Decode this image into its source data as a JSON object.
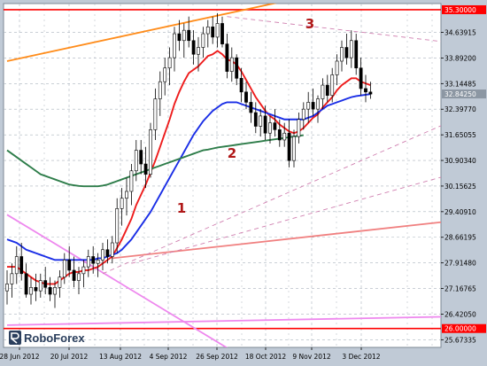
{
  "chart_data": {
    "type": "line",
    "title": "",
    "xlabel": "",
    "ylabel": "",
    "ylim": [
      25.45,
      35.48
    ],
    "grid": true,
    "x_tick_labels": [
      "28 Jun 2012",
      "20 Jul 2012",
      "13 Aug 2012",
      "4 Sep 2012",
      "26 Sep 2012",
      "18 Oct 2012",
      "9 Nov 2012",
      "3 Dec 2012"
    ],
    "y_tick_labels": [
      "34.63915",
      "33.89200",
      "33.14485",
      "32.39770",
      "31.65055",
      "30.90340",
      "30.15625",
      "29.40910",
      "28.66195",
      "27.91480",
      "27.16765",
      "26.42050",
      "25.67335"
    ],
    "y_tick_values": [
      34.63915,
      33.892,
      33.14485,
      32.3977,
      31.65055,
      30.9034,
      30.15625,
      29.4091,
      28.66195,
      27.9148,
      27.16765,
      26.4205,
      25.67335
    ],
    "level_labels": [
      "35.30000",
      "26.00000"
    ],
    "level_values": [
      35.3,
      26.0
    ],
    "current_price_label": "32.84250",
    "current_price": 32.8425,
    "candles": [
      [
        27.1,
        27.7,
        26.7,
        27.3
      ],
      [
        27.3,
        27.9,
        26.9,
        27.6
      ],
      [
        27.6,
        28.4,
        27.3,
        28.1
      ],
      [
        28.1,
        28.5,
        27.4,
        27.6
      ],
      [
        27.6,
        27.9,
        26.9,
        27.0
      ],
      [
        27.0,
        27.5,
        26.7,
        27.2
      ],
      [
        27.2,
        27.6,
        26.8,
        27.1
      ],
      [
        27.1,
        27.6,
        26.9,
        27.4
      ],
      [
        27.4,
        27.8,
        27.0,
        27.2
      ],
      [
        27.2,
        27.5,
        26.8,
        27.0
      ],
      [
        27.0,
        27.4,
        26.6,
        27.2
      ],
      [
        27.2,
        27.7,
        26.9,
        27.5
      ],
      [
        27.5,
        28.2,
        27.3,
        28.0
      ],
      [
        28.0,
        28.4,
        27.5,
        27.7
      ],
      [
        27.7,
        28.1,
        27.2,
        27.4
      ],
      [
        27.4,
        27.8,
        27.0,
        27.6
      ],
      [
        27.6,
        28.0,
        27.2,
        27.8
      ],
      [
        27.8,
        28.3,
        27.5,
        28.1
      ],
      [
        28.1,
        28.4,
        27.6,
        27.9
      ],
      [
        27.9,
        28.2,
        27.5,
        28.0
      ],
      [
        28.0,
        28.5,
        27.7,
        28.3
      ],
      [
        28.3,
        28.6,
        27.9,
        28.1
      ],
      [
        28.1,
        28.7,
        27.9,
        28.5
      ],
      [
        28.5,
        29.8,
        28.2,
        29.5
      ],
      [
        29.5,
        30.1,
        29.0,
        29.8
      ],
      [
        29.8,
        30.4,
        29.3,
        30.0
      ],
      [
        30.0,
        30.8,
        29.6,
        30.6
      ],
      [
        30.6,
        31.5,
        30.3,
        31.2
      ],
      [
        31.2,
        31.5,
        30.5,
        30.8
      ],
      [
        30.8,
        31.3,
        30.1,
        30.5
      ],
      [
        30.5,
        32.0,
        30.4,
        31.8
      ],
      [
        31.8,
        33.0,
        31.5,
        32.7
      ],
      [
        32.7,
        33.5,
        32.2,
        33.2
      ],
      [
        33.2,
        33.9,
        32.8,
        33.6
      ],
      [
        33.6,
        34.2,
        33.1,
        33.9
      ],
      [
        33.9,
        34.8,
        33.5,
        34.6
      ],
      [
        34.6,
        35.0,
        34.1,
        34.4
      ],
      [
        34.4,
        34.9,
        33.9,
        34.7
      ],
      [
        34.7,
        35.1,
        34.2,
        34.4
      ],
      [
        34.4,
        34.7,
        33.7,
        34.0
      ],
      [
        34.0,
        34.5,
        33.5,
        34.2
      ],
      [
        34.2,
        34.8,
        33.9,
        34.6
      ],
      [
        34.6,
        35.0,
        34.2,
        34.8
      ],
      [
        34.8,
        35.1,
        34.3,
        34.5
      ],
      [
        34.5,
        35.2,
        34.2,
        34.9
      ],
      [
        34.9,
        35.1,
        34.2,
        34.3
      ],
      [
        34.3,
        34.6,
        33.3,
        33.5
      ],
      [
        33.5,
        34.2,
        33.2,
        33.9
      ],
      [
        33.9,
        34.0,
        33.1,
        33.3
      ],
      [
        33.3,
        33.6,
        32.6,
        32.9
      ],
      [
        32.9,
        33.2,
        32.4,
        32.6
      ],
      [
        32.6,
        32.9,
        32.0,
        32.3
      ],
      [
        32.3,
        32.6,
        31.7,
        31.9
      ],
      [
        31.9,
        32.4,
        31.6,
        32.2
      ],
      [
        32.2,
        32.5,
        31.5,
        31.7
      ],
      [
        31.7,
        32.2,
        31.4,
        32.0
      ],
      [
        32.0,
        32.4,
        31.6,
        31.8
      ],
      [
        31.8,
        32.1,
        31.3,
        31.5
      ],
      [
        31.5,
        32.0,
        31.3,
        31.7
      ],
      [
        31.7,
        32.1,
        30.7,
        30.9
      ],
      [
        30.9,
        31.8,
        30.7,
        31.6
      ],
      [
        31.6,
        32.3,
        31.4,
        32.1
      ],
      [
        32.1,
        32.6,
        31.8,
        32.4
      ],
      [
        32.4,
        32.9,
        32.0,
        32.6
      ],
      [
        32.6,
        33.0,
        32.2,
        32.4
      ],
      [
        32.4,
        32.8,
        32.0,
        32.7
      ],
      [
        32.7,
        33.3,
        32.4,
        33.1
      ],
      [
        33.1,
        33.4,
        32.6,
        32.8
      ],
      [
        32.8,
        33.6,
        32.6,
        33.4
      ],
      [
        33.4,
        34.0,
        33.1,
        33.8
      ],
      [
        33.8,
        34.4,
        33.5,
        34.2
      ],
      [
        34.2,
        34.6,
        33.7,
        33.9
      ],
      [
        33.9,
        34.7,
        33.6,
        34.4
      ],
      [
        34.4,
        34.6,
        33.4,
        33.6
      ],
      [
        33.6,
        33.9,
        32.8,
        33.0
      ],
      [
        33.0,
        33.4,
        32.6,
        32.9
      ],
      [
        32.9,
        33.2,
        32.7,
        32.84
      ]
    ],
    "series": [
      {
        "color": "#ee1c1c",
        "values": [
          27.8,
          27.8,
          27.8,
          27.7,
          27.6,
          27.5,
          27.4,
          27.35,
          27.3,
          27.3,
          27.3,
          27.4,
          27.5,
          27.6,
          27.65,
          27.65,
          27.7,
          27.7,
          27.75,
          27.8,
          27.9,
          28.0,
          28.1,
          28.35,
          28.6,
          28.9,
          29.2,
          29.6,
          29.9,
          30.2,
          30.55,
          30.9,
          31.3,
          31.7,
          32.1,
          32.55,
          32.9,
          33.2,
          33.45,
          33.55,
          33.65,
          33.8,
          33.95,
          34.0,
          34.1,
          34.0,
          33.85,
          33.8,
          33.7,
          33.5,
          33.25,
          33.0,
          32.75,
          32.55,
          32.35,
          32.2,
          32.1,
          31.95,
          31.85,
          31.75,
          31.7,
          31.75,
          31.85,
          32.0,
          32.15,
          32.25,
          32.45,
          32.6,
          32.75,
          32.95,
          33.1,
          33.2,
          33.3,
          33.3,
          33.2,
          33.15,
          33.1
        ]
      },
      {
        "color": "#1a2ee6",
        "values": [
          28.6,
          28.55,
          28.5,
          28.4,
          28.3,
          28.25,
          28.2,
          28.15,
          28.1,
          28.05,
          28.0,
          28.0,
          28.0,
          28.0,
          28.0,
          28.0,
          28.0,
          28.0,
          28.0,
          28.05,
          28.05,
          28.1,
          28.15,
          28.2,
          28.3,
          28.45,
          28.6,
          28.8,
          29.0,
          29.2,
          29.4,
          29.65,
          29.9,
          30.15,
          30.4,
          30.65,
          30.9,
          31.15,
          31.4,
          31.65,
          31.85,
          32.05,
          32.2,
          32.35,
          32.45,
          32.55,
          32.6,
          32.6,
          32.6,
          32.55,
          32.5,
          32.45,
          32.4,
          32.35,
          32.3,
          32.25,
          32.2,
          32.15,
          32.1,
          32.1,
          32.1,
          32.1,
          32.1,
          32.15,
          32.2,
          32.3,
          32.4,
          32.5,
          32.55,
          32.6,
          32.65,
          32.7,
          32.75,
          32.78,
          32.8,
          32.82,
          32.84
        ]
      },
      {
        "color": "#2e7d4a",
        "values": [
          31.2,
          31.1,
          31.0,
          30.9,
          30.8,
          30.7,
          30.6,
          30.5,
          30.45,
          30.4,
          30.35,
          30.3,
          30.25,
          30.2,
          30.18,
          30.16,
          30.15,
          30.15,
          30.15,
          30.15,
          30.17,
          30.2,
          30.25,
          30.3,
          30.35,
          30.4,
          30.45,
          30.5,
          30.55,
          30.6,
          30.65,
          30.7,
          30.75,
          30.8,
          30.85,
          30.9,
          30.95,
          31.0,
          31.05,
          31.1,
          31.15,
          31.2,
          31.22,
          31.25,
          31.28,
          31.3,
          31.32,
          31.34,
          31.36,
          31.38,
          31.4,
          31.42,
          31.44,
          31.46,
          31.48,
          31.5,
          31.52,
          31.54,
          31.56,
          31.58,
          31.6,
          31.62,
          31.64
        ]
      }
    ],
    "annotations": [
      {
        "text": "1"
      },
      {
        "text": "2"
      },
      {
        "text": "3"
      }
    ],
    "trend_lines": [
      {
        "color": "#ff8c1a",
        "style": "solid",
        "from": [
          0,
          33.8
        ],
        "to": [
          58,
          35.55
        ]
      },
      {
        "color": "#f08080",
        "style": "solid",
        "from": [
          22,
          28.05
        ],
        "to": [
          120,
          29.55
        ]
      },
      {
        "color": "#ee88ee",
        "style": "solid",
        "from": [
          0,
          29.32
        ],
        "to": [
          50,
          25.1
        ]
      },
      {
        "color": "#ee88ee",
        "style": "solid",
        "from": [
          0,
          26.1
        ],
        "to": [
          120,
          26.42
        ]
      },
      {
        "color": "#d080b0",
        "style": "dashed",
        "from": [
          46,
          35.1
        ],
        "to": [
          120,
          33.9
        ]
      },
      {
        "color": "#d080b0",
        "style": "dashed",
        "from": [
          20,
          27.6
        ],
        "to": [
          120,
          33.7
        ]
      },
      {
        "color": "#d080b0",
        "style": "dashed",
        "from": [
          26,
          27.9
        ],
        "to": [
          120,
          31.55
        ]
      }
    ],
    "logo": "RoboForex"
  },
  "colors": {
    "background": "#c0cad6",
    "plot_background": "#ffffff",
    "grid": "#aab3bd",
    "level_line": "#ff0000",
    "candle_up": "#ffffff",
    "candle_down": "#000000"
  }
}
